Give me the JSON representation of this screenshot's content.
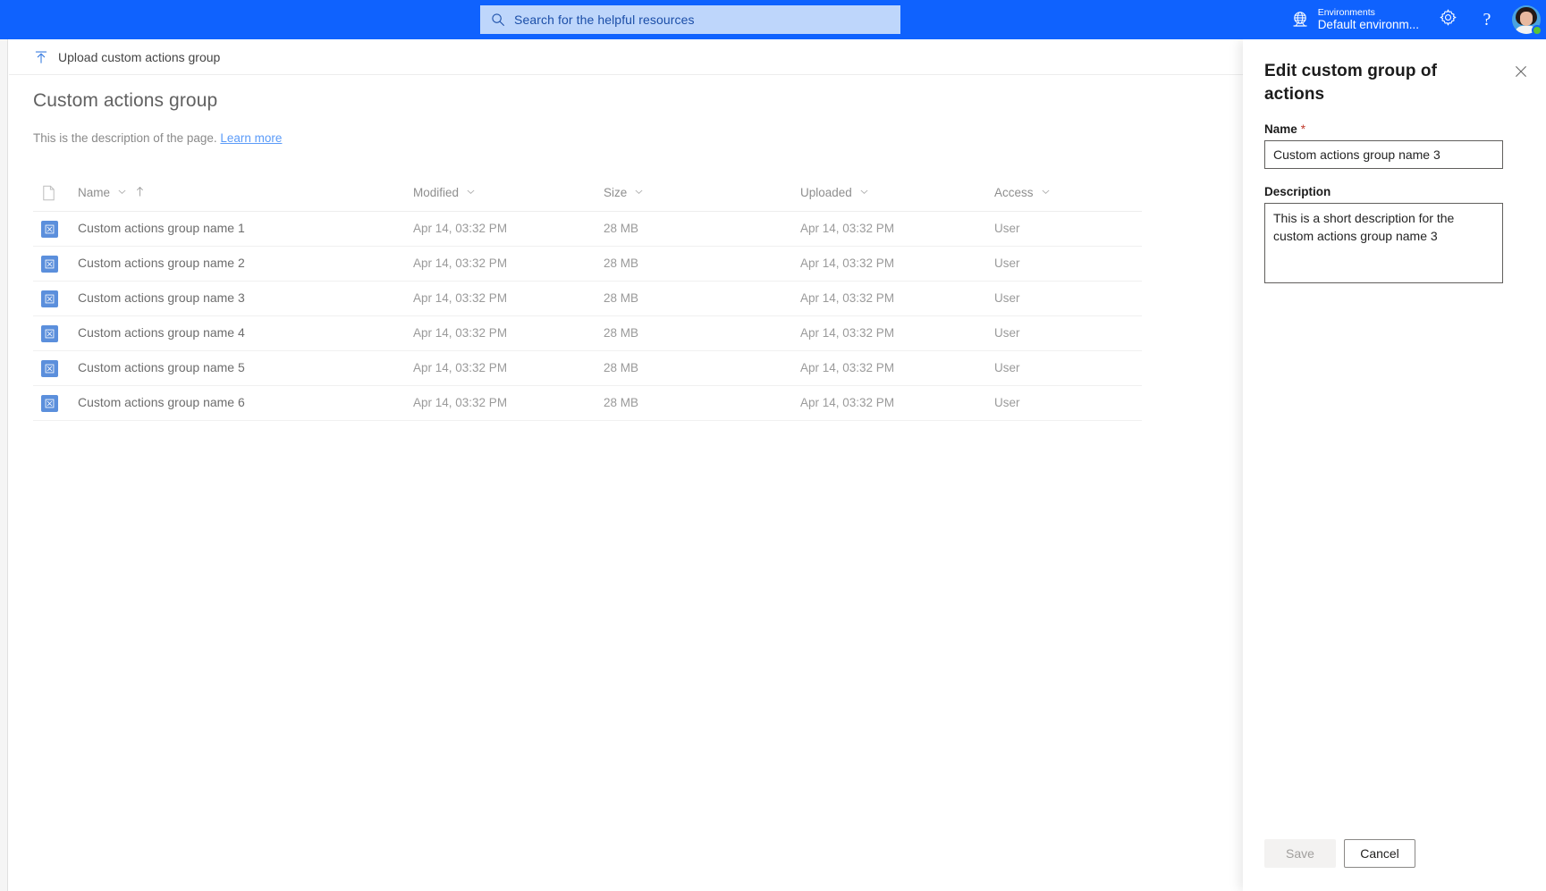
{
  "suitebar": {
    "search": {
      "placeholder": "Search for the helpful resources",
      "icon": "search-icon"
    },
    "environment": {
      "label": "Environments",
      "value": "Default environm...",
      "icon": "globe-icon"
    },
    "settings_icon": "gear-icon",
    "help_icon": "help-icon",
    "avatar": "user-avatar",
    "presence": "available"
  },
  "commandbar": {
    "upload": {
      "label": "Upload custom actions group",
      "icon": "upload-icon"
    }
  },
  "page": {
    "title": "Custom actions group",
    "description": "This is the description of the page.",
    "learn_more": "Learn more"
  },
  "table": {
    "columns": [
      {
        "key": "icon",
        "label": "",
        "icon": "document-icon",
        "sortable": false
      },
      {
        "key": "name",
        "label": "Name",
        "sortable": true,
        "sorted": "asc"
      },
      {
        "key": "modified",
        "label": "Modified",
        "sortable": true
      },
      {
        "key": "size",
        "label": "Size",
        "sortable": true
      },
      {
        "key": "uploaded",
        "label": "Uploaded",
        "sortable": true
      },
      {
        "key": "access",
        "label": "Access",
        "sortable": true
      }
    ],
    "rows": [
      {
        "icon": "custom-actions-group-icon",
        "name": "Custom actions group name 1",
        "modified": "Apr 14, 03:32 PM",
        "size": "28 MB",
        "uploaded": "Apr 14, 03:32 PM",
        "access": "User"
      },
      {
        "icon": "custom-actions-group-icon",
        "name": "Custom actions group name 2",
        "modified": "Apr 14, 03:32 PM",
        "size": "28 MB",
        "uploaded": "Apr 14, 03:32 PM",
        "access": "User"
      },
      {
        "icon": "custom-actions-group-icon",
        "name": "Custom actions group name 3",
        "modified": "Apr 14, 03:32 PM",
        "size": "28 MB",
        "uploaded": "Apr 14, 03:32 PM",
        "access": "User"
      },
      {
        "icon": "custom-actions-group-icon",
        "name": "Custom actions group name 4",
        "modified": "Apr 14, 03:32 PM",
        "size": "28 MB",
        "uploaded": "Apr 14, 03:32 PM",
        "access": "User"
      },
      {
        "icon": "custom-actions-group-icon",
        "name": "Custom actions group name 5",
        "modified": "Apr 14, 03:32 PM",
        "size": "28 MB",
        "uploaded": "Apr 14, 03:32 PM",
        "access": "User"
      },
      {
        "icon": "custom-actions-group-icon",
        "name": "Custom actions group name 6",
        "modified": "Apr 14, 03:32 PM",
        "size": "28 MB",
        "uploaded": "Apr 14, 03:32 PM",
        "access": "User"
      }
    ]
  },
  "panel": {
    "title": "Edit custom group of actions",
    "close_icon": "close-icon",
    "name_label": "Name",
    "name_required_marker": "*",
    "name_value": "Custom actions group name 3",
    "description_label": "Description",
    "description_value": "This is a short description for the custom actions group name 3",
    "save_label": "Save",
    "cancel_label": "Cancel"
  },
  "colors": {
    "brand_blue": "#0f62fe",
    "search_field": "#bed6fb",
    "link": "#5b9bf8",
    "required_red": "#c0392b",
    "row_icon": "#5b8fdc",
    "presence_green": "#5ac435"
  }
}
